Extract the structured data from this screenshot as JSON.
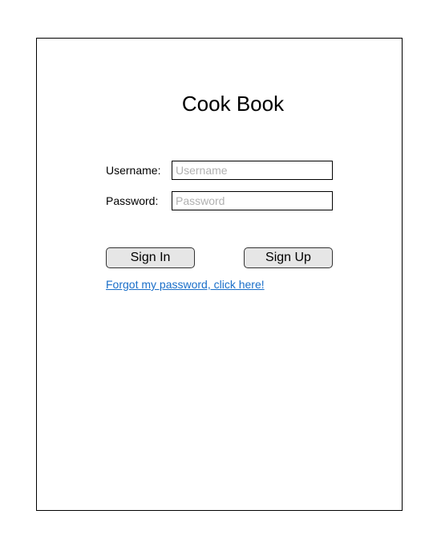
{
  "app": {
    "title": "Cook Book"
  },
  "form": {
    "username_label": "Username:",
    "username_placeholder": "Username",
    "username_value": "",
    "password_label": "Password:",
    "password_placeholder": "Password",
    "password_value": ""
  },
  "actions": {
    "sign_in_label": "Sign In",
    "sign_up_label": "Sign Up",
    "forgot_link": "Forgot my password, click here!"
  },
  "colors": {
    "link": "#1a6fc9",
    "button_bg": "#e6e6e6",
    "placeholder": "#b0b0b0"
  }
}
